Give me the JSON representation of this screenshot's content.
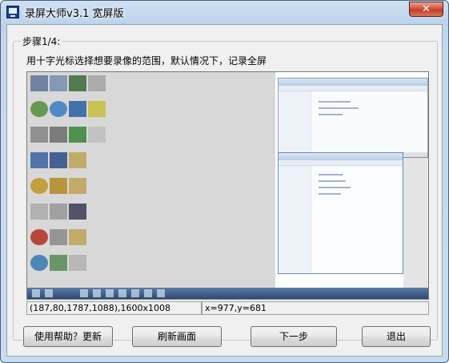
{
  "window": {
    "title": "录屏大师v3.1 宽屏版",
    "close_glyph": "✕"
  },
  "step": {
    "label": "步骤1/4:",
    "instruction": "用十字光标选择想要录像的范围，默认情况下，记录全屏"
  },
  "status": {
    "region": "(187,80,1787,1088),1600x1008",
    "cursor": "x=977,y=681"
  },
  "buttons": {
    "help": "使用帮助？更新",
    "refresh": "刷新画面",
    "next": "下一步",
    "exit": "退出"
  },
  "colors": {
    "title_gradient_top": "#cfe0f2",
    "close_red": "#c23c25",
    "client_bg": "#f0f0f0"
  }
}
